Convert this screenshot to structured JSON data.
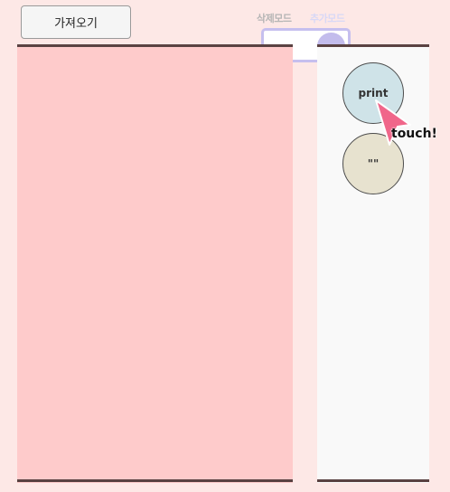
{
  "toolbar": {
    "fetch_label": "가져오기"
  },
  "mode_toggle": {
    "delete_mode_label": "삭제모드",
    "add_mode_label": "추가모드",
    "state": "add"
  },
  "palette": {
    "blocks": [
      {
        "label": "print",
        "color": "#cfe3e8"
      },
      {
        "label": "\"\"",
        "color": "#e7e2cf"
      }
    ]
  },
  "hint": {
    "icon": "pointer-arrow-icon",
    "label": "touch!",
    "color": "#f0668a"
  },
  "colors": {
    "background": "#fde8e6",
    "workspace": "#fecbcb",
    "palette_panel": "#f9f9f9",
    "toggle_accent": "#c6bfee"
  }
}
